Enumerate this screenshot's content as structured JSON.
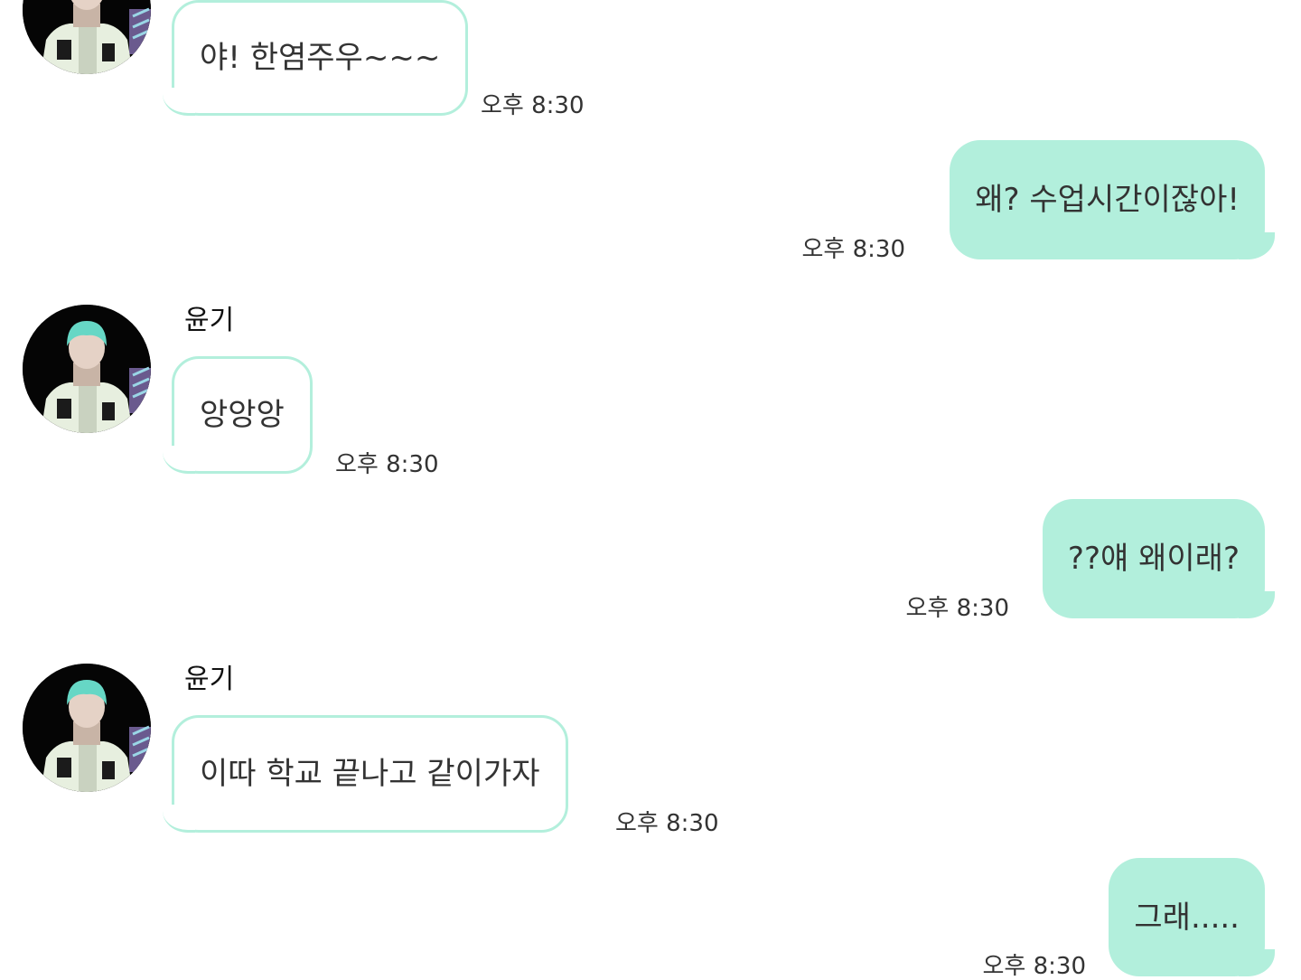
{
  "messages": [
    {
      "side": "left",
      "sender": "",
      "text": "야! 한염주우~~~",
      "time": "오후 8:30"
    },
    {
      "side": "right",
      "text": "왜? 수업시간이잖아!",
      "time": "오후 8:30"
    },
    {
      "side": "left",
      "sender": "윤기",
      "text": "앙앙앙",
      "time": "오후 8:30"
    },
    {
      "side": "right",
      "text": "??얘 왜이래?",
      "time": "오후 8:30"
    },
    {
      "side": "left",
      "sender": "윤기",
      "text": "이따 학교 끝나고 같이가자",
      "time": "오후 8:30"
    },
    {
      "side": "right",
      "text": "그래.....",
      "time": "오후 8:30"
    }
  ],
  "colors": {
    "bubble_accent": "#b2efdc",
    "incoming_bubble_fill": "#ffffff",
    "text": "#333333",
    "background": "#ffffff"
  },
  "icons": {
    "sender_avatar": "profile-photo-avatar"
  }
}
